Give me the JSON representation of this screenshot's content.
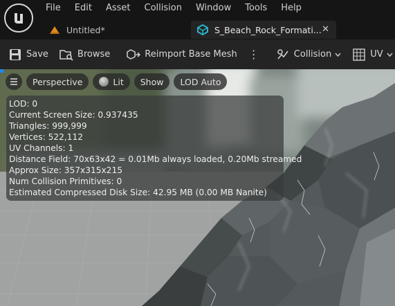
{
  "menu": [
    "File",
    "Edit",
    "Asset",
    "Collision",
    "Window",
    "Tools",
    "Help"
  ],
  "tabs": {
    "untitled": "Untitled*",
    "asset": "S_Beach_Rock_Formati..."
  },
  "toolbar": {
    "save": "Save",
    "browse": "Browse",
    "reimport": "Reimport Base Mesh",
    "collision": "Collision",
    "uv": "UV"
  },
  "viewport": {
    "perspective": "Perspective",
    "lit": "Lit",
    "show": "Show",
    "lod": "LOD Auto"
  },
  "stats": [
    {
      "label": "LOD:",
      "value": "0"
    },
    {
      "label": "Current Screen Size:",
      "value": "0.937435"
    },
    {
      "label": "Triangles:",
      "value": "999,999"
    },
    {
      "label": "Vertices:",
      "value": "522,112"
    },
    {
      "label": "UV Channels:",
      "value": "1"
    },
    {
      "label": "Distance Field:",
      "value": "70x63x42 = 0.01Mb always loaded, 0.20Mb streamed"
    },
    {
      "label": "Approx Size:",
      "value": "357x315x215"
    },
    {
      "label": "Num Collision Primitives:",
      "value": "0"
    },
    {
      "label": "Estimated Compressed Disk Size:",
      "value": "42.95 MB (0.00 MB Nanite)"
    }
  ],
  "colors": {
    "accent_blue": "#1a8cff",
    "tab_icon_cyan": "#29b3c9",
    "untitled_icon_orange": "#e08a1e",
    "toolbar_bg": "#242424",
    "titlebar_bg": "#151515"
  },
  "icons": {
    "logo": "unreal-engine-logo",
    "save": "floppy-disk-icon",
    "browse": "folder-search-icon",
    "reimport": "reimport-mesh-icon",
    "collision": "collision-icon",
    "uv": "uv-grid-icon",
    "viewport_menu": "hamburger-icon",
    "lit": "lit-sphere-icon"
  }
}
